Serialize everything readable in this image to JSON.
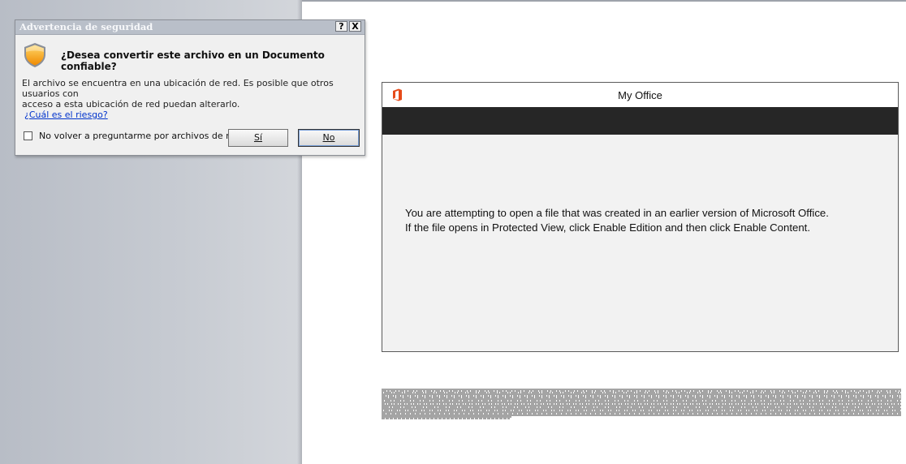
{
  "security_dialog": {
    "title": "Advertencia de seguridad",
    "help_button": "?",
    "close_button": "X",
    "question": "¿Desea convertir este archivo en un Documento confiable?",
    "message_line1": "El archivo se encuentra en una ubicación de red. Es posible que otros usuarios con",
    "message_line2": "acceso a esta ubicación de red puedan alterarlo.",
    "risk_link": "¿Cuál es el riesgo?",
    "checkbox_label": "No volver a preguntarme por archivos de red",
    "checkbox_checked": false,
    "yes_button": "Sí",
    "no_button": "No",
    "icon": "shield-warning-icon"
  },
  "office_card": {
    "title": "My Office",
    "logo_icon": "office-logo-icon",
    "accent_color": "#e64a19",
    "line1": "You are attempting to open a file that was created in an earlier version of Microsoft Office.",
    "line2": "If the file opens in Protected View, click Enable Edition and then click Enable Content."
  }
}
